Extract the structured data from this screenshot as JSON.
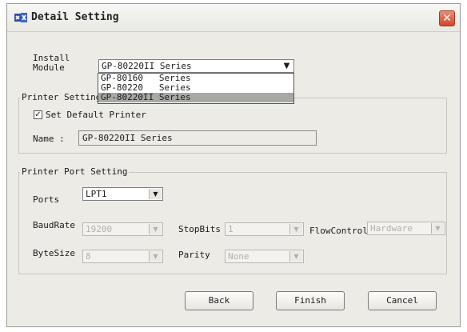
{
  "window": {
    "title": "Detail Setting",
    "close_glyph": "✕"
  },
  "install_module": {
    "label_line1": "Install",
    "label_line2": "Module",
    "selected": "GP-80220II Series",
    "options": [
      {
        "label": "GP-80160   Series",
        "selected": false
      },
      {
        "label": "GP-80220   Series",
        "selected": false
      },
      {
        "label": "GP-80220II Series",
        "selected": true
      }
    ]
  },
  "printer_setting": {
    "legend": "Printer Setting",
    "default_checkbox": {
      "label": "Set Default Printer",
      "checked": true
    },
    "name_label": "Name :",
    "name_value": "GP-80220II Series"
  },
  "port_setting": {
    "legend": "Printer Port Setting",
    "ports": {
      "label": "Ports",
      "value": "LPT1"
    },
    "baudrate": {
      "label": "BaudRate",
      "value": "19200"
    },
    "stopbits": {
      "label": "StopBits",
      "value": "1"
    },
    "flowcontrol": {
      "label": "FlowControl",
      "value": "Hardware"
    },
    "bytesize": {
      "label": "ByteSize",
      "value": "8"
    },
    "parity": {
      "label": "Parity",
      "value": "None"
    }
  },
  "buttons": {
    "back": "Back",
    "finish": "Finish",
    "cancel": "Cancel"
  },
  "icons": {
    "window_icon": "printer-wizard-icon",
    "dropdown_arrow": "▼",
    "check_mark": "✓"
  },
  "colors": {
    "dialog_bg": "#ecebe6",
    "close_button": "#d2452a",
    "selected_option_bg": "#a8a8a4"
  }
}
